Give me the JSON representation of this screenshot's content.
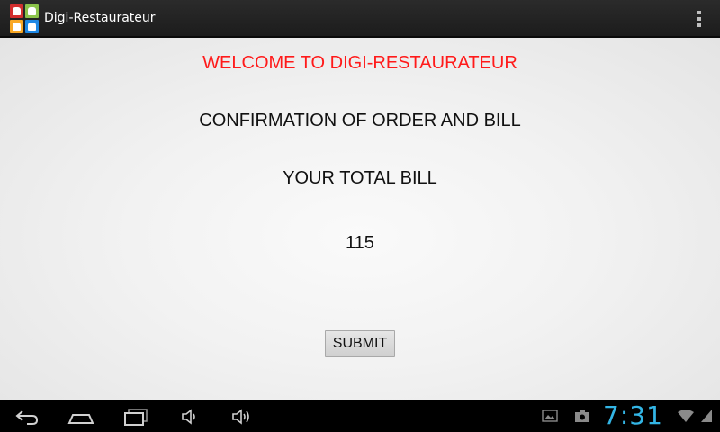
{
  "app": {
    "title": "Digi-Restaurateur",
    "logo_icon": "chef-hat-grid-icon",
    "logo_colors": [
      "#d32f2f",
      "#8bc34a",
      "#f9a825",
      "#1e88e5"
    ]
  },
  "main": {
    "welcome": "WELCOME TO DIGI-RESTAURATEUR",
    "welcome_color": "#ff1a1a",
    "heading": "CONFIRMATION OF ORDER AND BILL",
    "total_label": "YOUR TOTAL BILL",
    "total_value": "115",
    "submit_label": "SUBMIT"
  },
  "system_bar": {
    "clock": "7:31",
    "accent": "#33b5e5",
    "icons": [
      "back-icon",
      "home-icon",
      "recents-icon",
      "volume-down-icon",
      "volume-up-icon",
      "gallery-icon",
      "camera-icon",
      "wifi-icon",
      "battery-icon"
    ]
  }
}
